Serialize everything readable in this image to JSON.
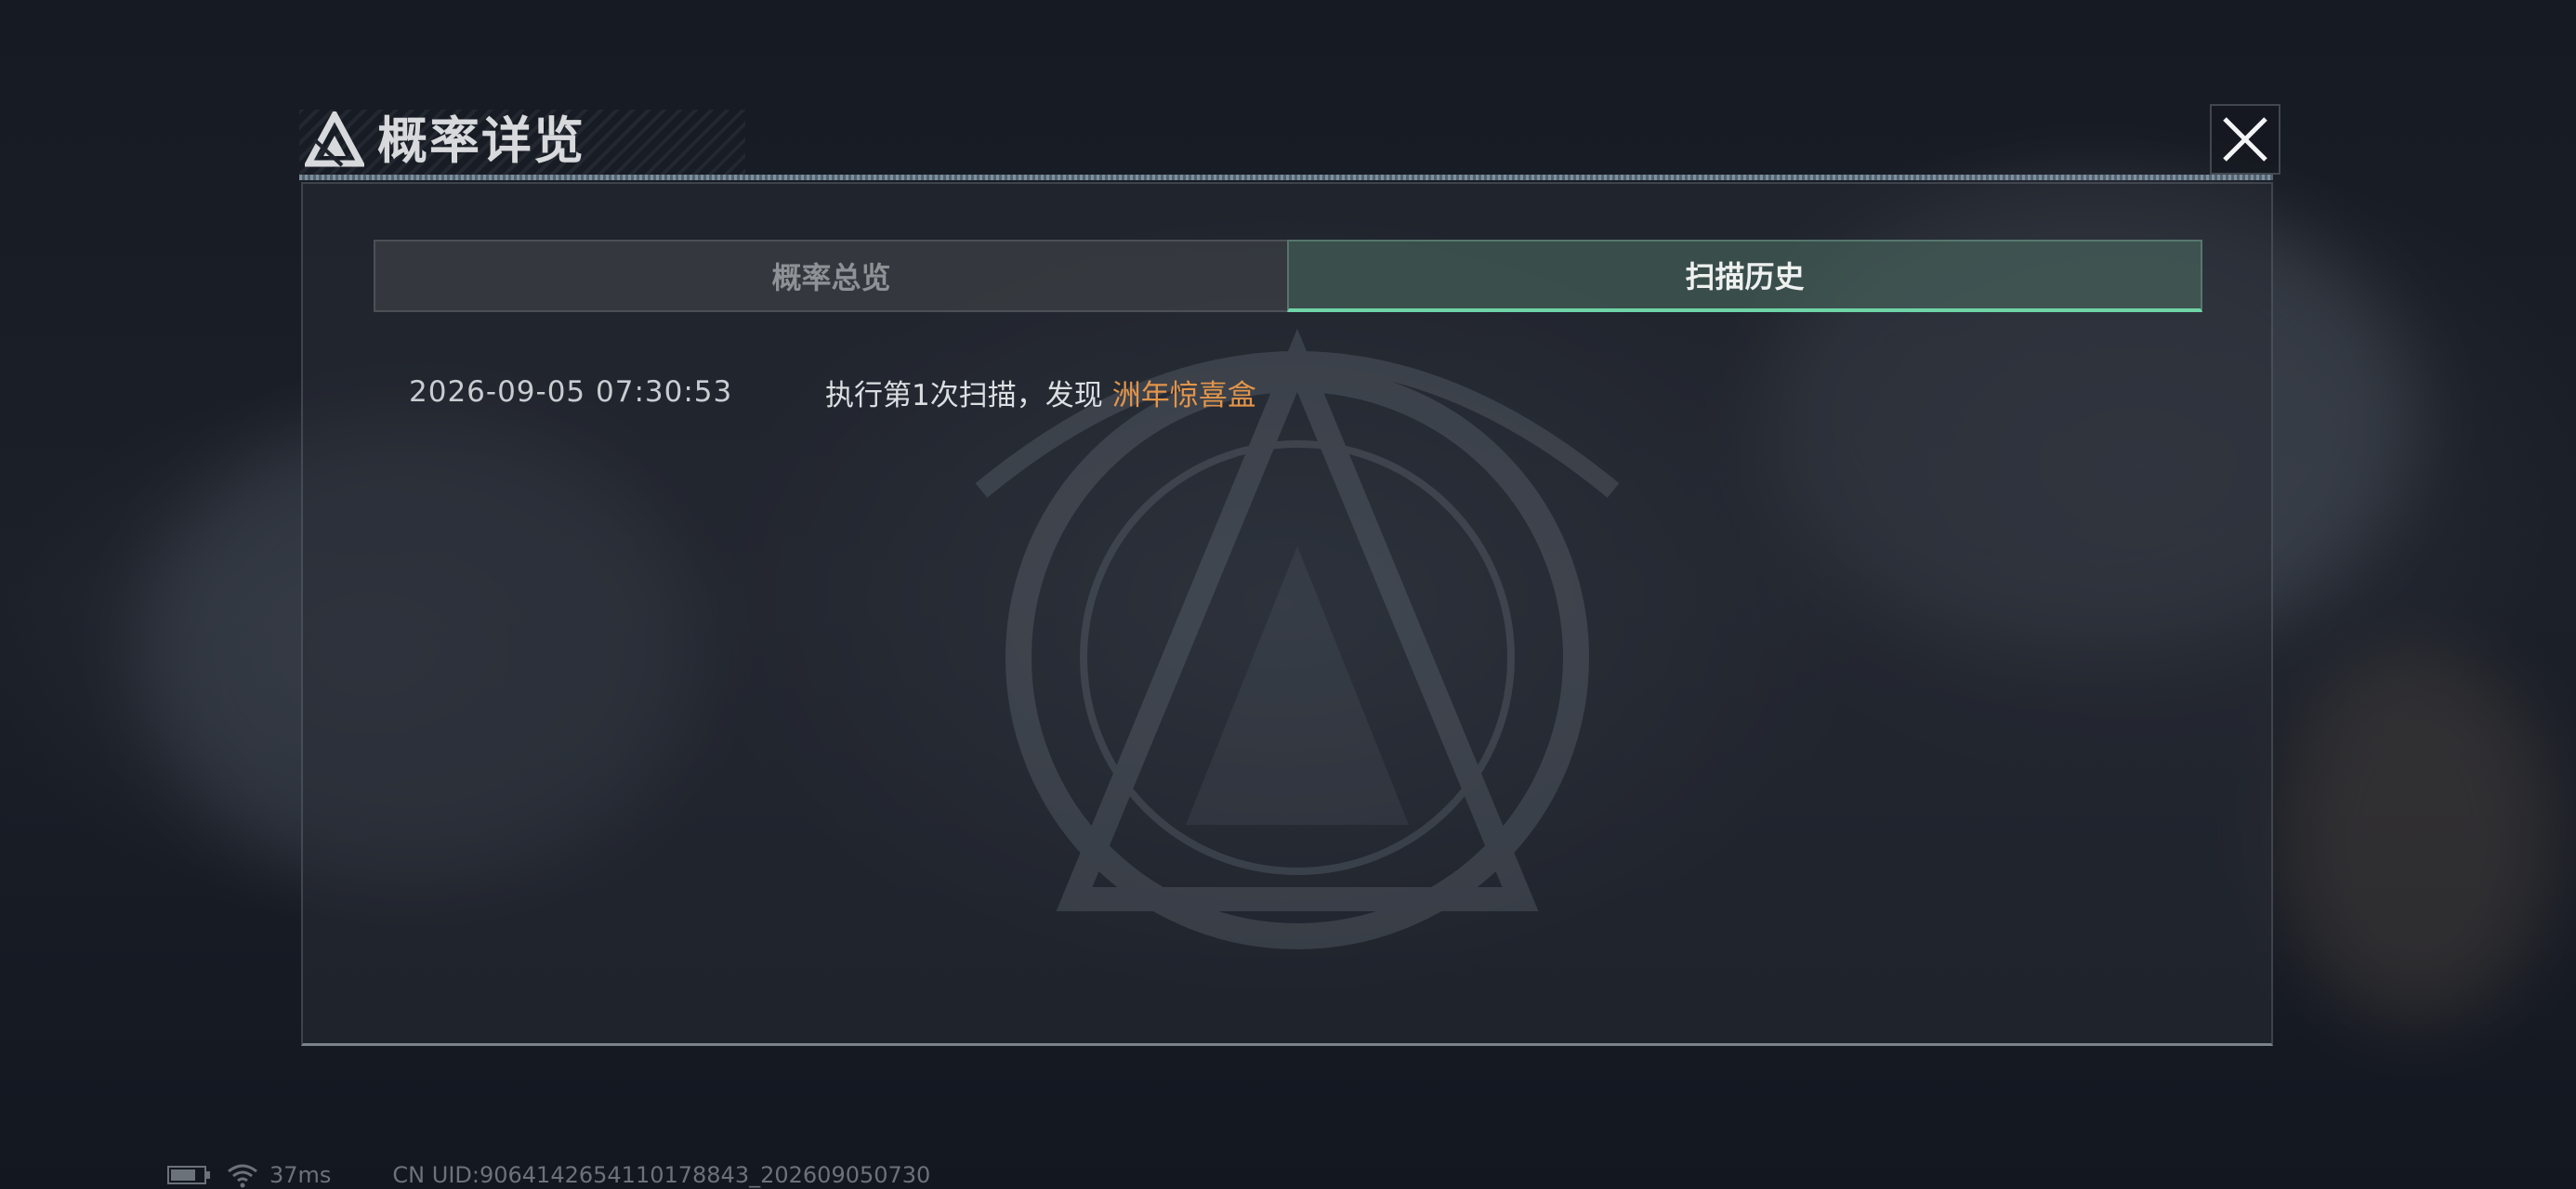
{
  "dialog": {
    "title": "概率详览",
    "close_icon": "close-icon",
    "logo_icon": "triangle-logo-icon"
  },
  "tabs": [
    {
      "label": "概率总览",
      "active": false
    },
    {
      "label": "扫描历史",
      "active": true
    }
  ],
  "records": [
    {
      "time": "2026-09-05 07:30:53",
      "desc": "执行第1次扫描，发现",
      "item": "洲年惊喜盒"
    }
  ],
  "status_bar": {
    "battery_icon": "battery-icon",
    "wifi_icon": "wifi-icon",
    "ping": "37ms",
    "uid": "CN UID:9064142654110178843_202609050730"
  },
  "colors": {
    "active_tab_underline": "#6fd5a8",
    "item_highlight": "#e2954a",
    "active_tab_bg": "#4e7064"
  }
}
